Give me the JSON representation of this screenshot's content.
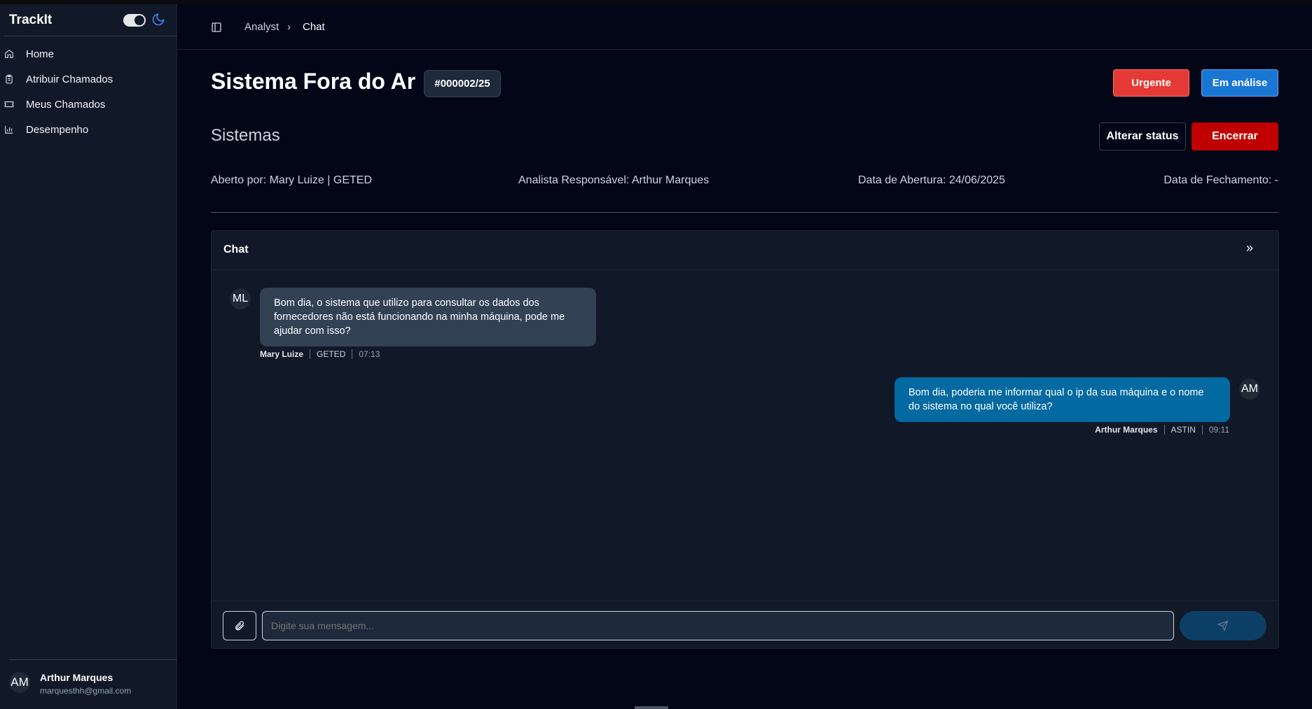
{
  "sidebar": {
    "brand": "TrackIt",
    "items": [
      {
        "label": "Home",
        "icon": "home-icon"
      },
      {
        "label": "Atribuir Chamados",
        "icon": "clipboard-icon"
      },
      {
        "label": "Meus Chamados",
        "icon": "ticket-icon"
      },
      {
        "label": "Desempenho",
        "icon": "bar-chart-icon"
      }
    ],
    "user": {
      "initials": "AM",
      "name": "Arthur Marques",
      "email": "marquesthh@gmail.com"
    }
  },
  "breadcrumb": {
    "parent": "Analyst",
    "current": "Chat"
  },
  "ticket": {
    "title": "Sistema Fora do Ar",
    "id": "#000002/25",
    "priority": "Urgente",
    "status": "Em análise",
    "category": "Sistemas",
    "alter_status": "Alterar status",
    "close": "Encerrar",
    "opened_by": "Aberto por: Mary Luize | GETED",
    "analyst": "Analista Responsável: Arthur Marques",
    "open_date": "Data de Abertura: 24/06/2025",
    "close_date": "Data de Fechamento: -"
  },
  "chat": {
    "title": "Chat",
    "messages": [
      {
        "initials": "ML",
        "text": "Bom dia, o sistema que utilizo para consultar os dados dos fornecedores não está funcionando na minha máquina, pode me ajudar com isso?",
        "author": "Mary Luize",
        "dept": "GETED",
        "time": "07:13"
      },
      {
        "initials": "AM",
        "text": "Bom dia, poderia me informar qual o ip da sua máquina e o nome do sistema no qual você utiliza?",
        "author": "Arthur Marques",
        "dept": "ASTIN",
        "time": "09:11"
      }
    ],
    "placeholder": "Digite sua mensagem..."
  },
  "colors": {
    "urgent": "#e53935",
    "status": "#1976d2",
    "close": "#c00000",
    "own_bubble": "#0369a1",
    "other_bubble": "#334155"
  }
}
